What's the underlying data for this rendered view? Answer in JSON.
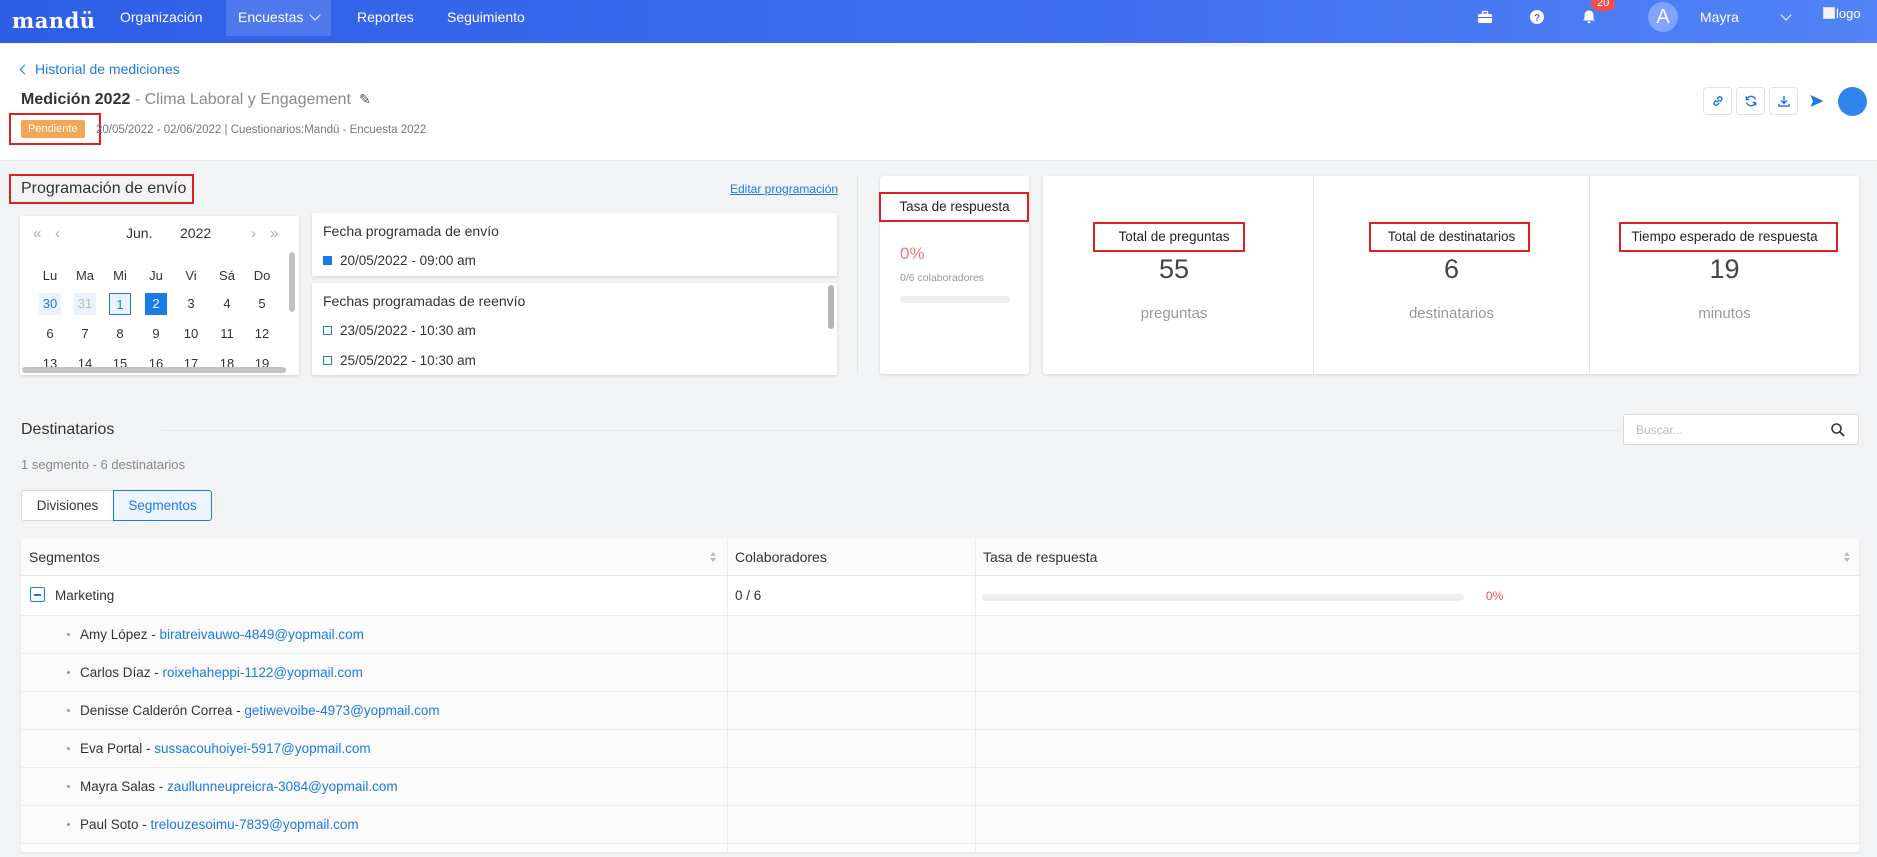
{
  "app": {
    "logo": "mandü"
  },
  "nav": {
    "items": [
      {
        "label": "Organización"
      },
      {
        "label": "Encuestas"
      },
      {
        "label": "Reportes"
      },
      {
        "label": "Seguimiento"
      }
    ]
  },
  "user": {
    "notifications_count": "20",
    "avatar_initial": "A",
    "name": "Mayra",
    "logo_alt": "logo"
  },
  "header": {
    "back_link": "Historial de mediciones",
    "title": "Medición 2022",
    "subtitle": " - Clima Laboral y Engagement",
    "status": "Pendiente",
    "meta": "20/05/2022 - 02/06/2022 | Cuestionarios:Mandü - Encuesta 2022",
    "action_icons": [
      "link-icon",
      "refresh-icon",
      "download-icon",
      "send-icon",
      "circle-icon"
    ]
  },
  "schedule": {
    "title": "Programación de envío",
    "edit_link": "Editar programación",
    "calendar": {
      "month": "Jun.",
      "year": "2022",
      "weekdays": [
        "Lu",
        "Ma",
        "Mi",
        "Ju",
        "Vi",
        "Sá",
        "Do"
      ],
      "rows": [
        [
          "30",
          "31",
          "1",
          "2",
          "3",
          "4",
          "5"
        ],
        [
          "6",
          "7",
          "8",
          "9",
          "10",
          "11",
          "12"
        ],
        [
          "13",
          "14",
          "15",
          "16",
          "17",
          "18",
          "19"
        ]
      ]
    },
    "send_title": "Fecha programada de envío",
    "send_date": "20/05/2022 - 09:00 am",
    "resend_title": "Fechas programadas de reenvío",
    "resend_dates": [
      "23/05/2022 - 10:30 am",
      "25/05/2022 - 10:30 am"
    ]
  },
  "response_rate": {
    "title": "Tasa de respuesta",
    "value": "0%",
    "sub": "0/6 colaboradores",
    "fraction": 0
  },
  "stats": [
    {
      "label": "Total de preguntas",
      "value": "55",
      "unit": "preguntas"
    },
    {
      "label": "Total de destinatarios",
      "value": "6",
      "unit": "destinatarios"
    },
    {
      "label": "Tiempo esperado de respuesta",
      "value": "19",
      "unit": "minutos"
    }
  ],
  "recipients": {
    "title": "Destinatarios",
    "search_placeholder": "Buscar...",
    "summary": "1 segmento - 6 destinatarios",
    "tabs": [
      {
        "label": "Divisiones"
      },
      {
        "label": "Segmentos"
      }
    ],
    "columns": [
      "Segmentos",
      "Colaboradores",
      "Tasa de respuesta"
    ],
    "group": {
      "name": "Marketing",
      "collaborators": "0 / 6",
      "rate": "0%",
      "rate_fraction": 0
    },
    "people": [
      {
        "name": "Amy López",
        "email": "biratreivauwo-4849@yopmail.com"
      },
      {
        "name": "Carlos Díaz",
        "email": "roixehaheppi-1122@yopmail.com"
      },
      {
        "name": "Denisse Calderón Correa",
        "email": "getiwevoibe-4973@yopmail.com"
      },
      {
        "name": "Eva Portal",
        "email": "sussacouhoiyei-5917@yopmail.com"
      },
      {
        "name": "Mayra Salas",
        "email": "zaullunneupreicra-3084@yopmail.com"
      },
      {
        "name": "Paul Soto",
        "email": "trelouzesoimu-7839@yopmail.com"
      }
    ]
  },
  "colors": {
    "accent": "#1a7be6",
    "topbar": "#3f6ff0",
    "pending": "#f3a756",
    "danger": "#f05050",
    "highlight_box": "#e02020"
  }
}
